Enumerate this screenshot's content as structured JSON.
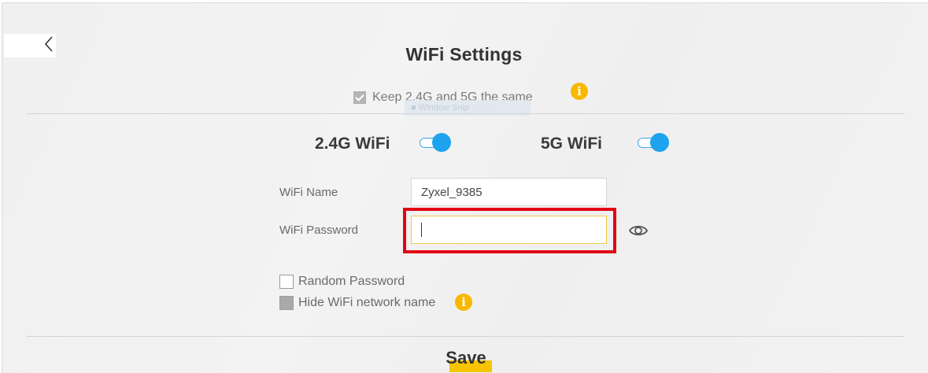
{
  "header": {
    "back_icon": "chevron-left-icon",
    "title": "WiFi Settings"
  },
  "sync": {
    "keep_same_checked": true,
    "keep_same_label": "Keep 2.4G and 5G the same",
    "info_icon": "info-icon",
    "tooltip_ghost_text": "Window Snip"
  },
  "bands": [
    {
      "label": "2.4G WiFi",
      "enabled": true
    },
    {
      "label": "5G WiFi",
      "enabled": true
    }
  ],
  "form": {
    "wifi_name_label": "WiFi Name",
    "wifi_name_value": "Zyxel_9385",
    "wifi_password_label": "WiFi Password",
    "wifi_password_value": "",
    "show_password_icon": "eye-icon"
  },
  "options": {
    "random_password_label": "Random Password",
    "random_password_checked": false,
    "hide_network_label": "Hide WiFi network name",
    "hide_network_checked": false,
    "hide_network_info_icon": "info-icon"
  },
  "footer": {
    "save_label": "Save"
  },
  "colors": {
    "accent_blue": "#1fa3ee",
    "accent_yellow": "#f6c400",
    "highlight_red": "#e30613",
    "background": "#f1f1f1"
  }
}
